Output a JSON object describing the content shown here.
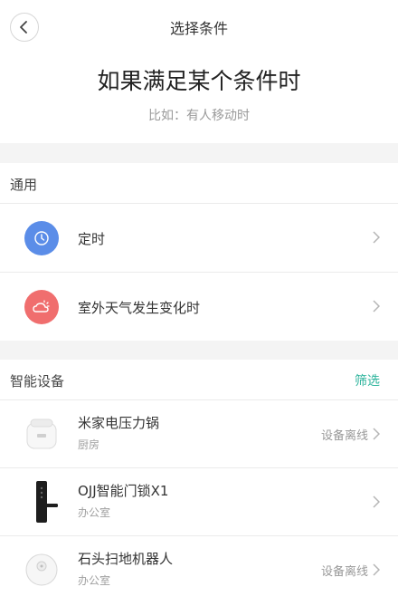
{
  "nav": {
    "title": "选择条件"
  },
  "heading": {
    "title": "如果满足某个条件时",
    "subtitle": "比如：有人移动时"
  },
  "general": {
    "title": "通用",
    "items": [
      {
        "label": "定时",
        "icon": "clock-icon",
        "color": "#5b8de8"
      },
      {
        "label": "室外天气发生变化时",
        "icon": "weather-icon",
        "color": "#f06e6e"
      }
    ]
  },
  "devices": {
    "title": "智能设备",
    "filter_label": "筛选",
    "filter_color": "#2bb39b",
    "items": [
      {
        "name": "米家电压力锅",
        "room": "厨房",
        "status": "设备离线",
        "icon": "pressure-cooker-icon"
      },
      {
        "name": "OJJ智能门锁X1",
        "room": "办公室",
        "status": "",
        "icon": "door-lock-icon"
      },
      {
        "name": "石头扫地机器人",
        "room": "办公室",
        "status": "设备离线",
        "icon": "robot-vacuum-icon"
      }
    ]
  }
}
